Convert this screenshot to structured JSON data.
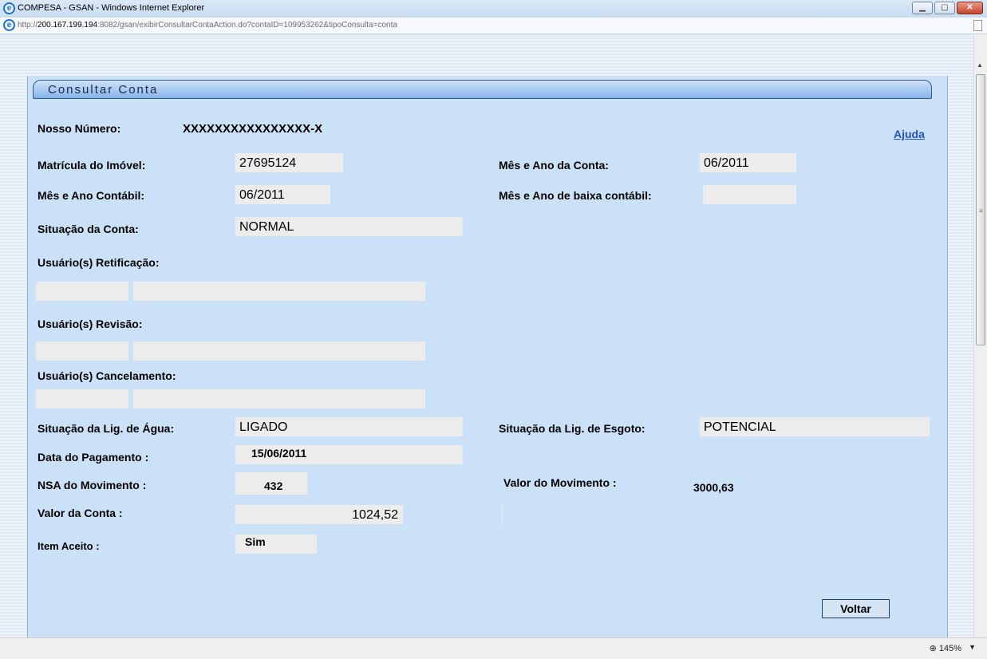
{
  "window": {
    "title": "COMPESA - GSAN - Windows Internet Explorer",
    "url_host": "200.167.199.194",
    "url_prefix": "http://",
    "url_rest": ":8082/gsan/exibirConsultarContaAction.do?contaID=109953262&tipoConsulta=conta",
    "zoom": "145%"
  },
  "panel": {
    "title": "Consultar Conta",
    "help_link": "Ajuda"
  },
  "fields": {
    "nosso_numero_label": "Nosso Número:",
    "nosso_numero_value": "XXXXXXXXXXXXXXXX-X",
    "matricula_label": "Matrícula do Imóvel:",
    "matricula_value": "27695124",
    "mes_ano_conta_label": "Mês e Ano da Conta:",
    "mes_ano_conta_value": "06/2011",
    "mes_ano_contabil_label": "Mês e Ano Contábil:",
    "mes_ano_contabil_value": "06/2011",
    "mes_ano_baixa_label": "Mês e Ano de baixa contábil:",
    "mes_ano_baixa_value": "",
    "situacao_conta_label": "Situação da Conta:",
    "situacao_conta_value": "NORMAL",
    "usuarios_retificacao_label": "Usuário(s) Retificação:",
    "usuarios_revisao_label": "Usuário(s) Revisão:",
    "usuarios_cancelamento_label": "Usuário(s) Cancelamento:",
    "situacao_agua_label": "Situação da Lig. de Água:",
    "situacao_agua_value": "LIGADO",
    "situacao_esgoto_label": "Situação da Lig. de Esgoto:",
    "situacao_esgoto_value": "POTENCIAL",
    "data_pagamento_label": "Data do Pagamento :",
    "data_pagamento_value": "15/06/2011",
    "nsa_label": "NSA do Movimento :",
    "nsa_value": "432",
    "valor_movimento_label": "Valor do Movimento :",
    "valor_movimento_value": "3000,63",
    "valor_conta_label": "Valor da Conta :",
    "valor_conta_value": "1024,52",
    "item_aceito_label": "Item Aceito :",
    "item_aceito_value": "Sim"
  },
  "buttons": {
    "voltar": "Voltar"
  },
  "icons": {
    "ie": "ie-logo-icon",
    "minimize": "minimize-icon",
    "maximize": "maximize-icon",
    "close": "close-icon",
    "zoom": "zoom-icon"
  }
}
